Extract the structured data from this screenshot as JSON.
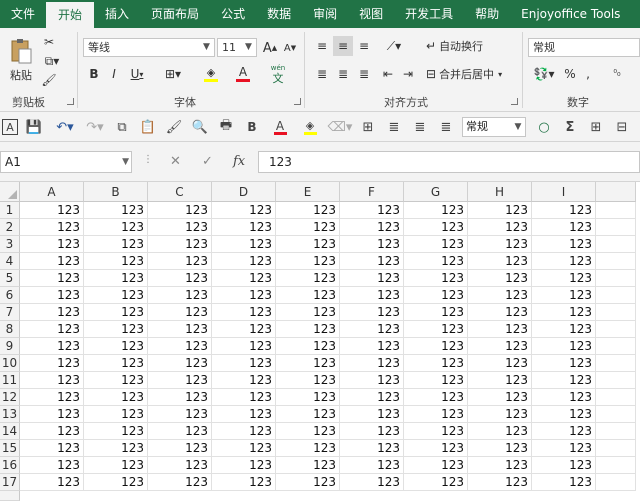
{
  "menu": {
    "tabs": [
      "文件",
      "开始",
      "插入",
      "页面布局",
      "公式",
      "数据",
      "审阅",
      "视图",
      "开发工具",
      "帮助",
      "Enjoyoffice Tools"
    ],
    "active": "开始"
  },
  "ribbon": {
    "clipboard": {
      "paste_label": "粘贴",
      "group_label": "剪贴板"
    },
    "font": {
      "name": "等线",
      "size": "11",
      "grow": "A",
      "shrink": "A",
      "bold": "B",
      "italic": "I",
      "underline": "U",
      "font_color_letter": "A",
      "phonetic_top": "wén",
      "phonetic_bottom": "文",
      "group_label": "字体"
    },
    "alignment": {
      "wrap_label": "自动换行",
      "merge_label": "合并后居中",
      "group_label": "对齐方式"
    },
    "number": {
      "format": "常规",
      "percent": "%",
      "comma": ",",
      "group_label": "数字"
    }
  },
  "qat": {
    "format_value": "常规",
    "bold": "B",
    "font_color_letter": "A"
  },
  "formula_bar": {
    "name_box": "A1",
    "fx": "fx",
    "cancel": "✕",
    "enter": "✓",
    "content": "123"
  },
  "sheet": {
    "columns": [
      "A",
      "B",
      "C",
      "D",
      "E",
      "F",
      "G",
      "H",
      "I"
    ],
    "rows": [
      "1",
      "2",
      "3",
      "4",
      "5",
      "6",
      "7",
      "8",
      "9",
      "10",
      "11",
      "12",
      "13",
      "14",
      "15",
      "16",
      "17"
    ],
    "cell_value": "123"
  },
  "colors": {
    "brand": "#217346",
    "font_red": "#e81123",
    "highlight_yellow": "#ffff00"
  }
}
